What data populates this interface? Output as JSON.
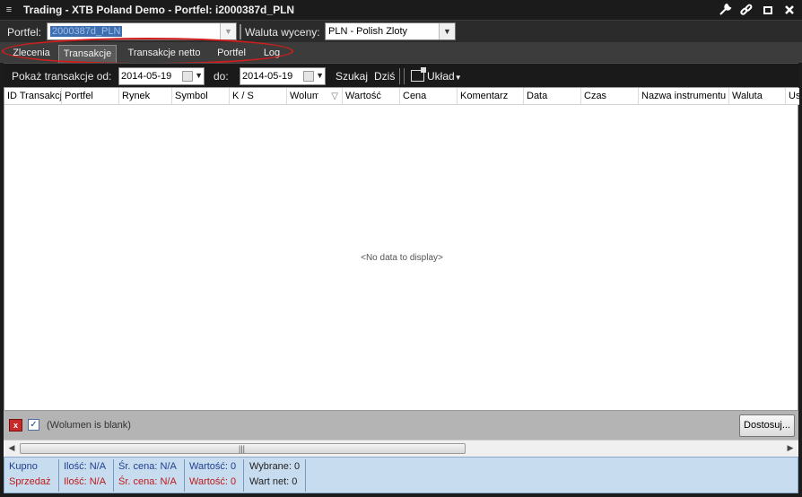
{
  "window": {
    "title": "Trading - XTB Poland Demo - Portfel: i2000387d_PLN",
    "menu_glyph": "≡"
  },
  "portfolio_row": {
    "portfel_label": "Portfel:",
    "portfel_value": "2000387d_PLN",
    "waluta_label": "Waluta wyceny:",
    "waluta_value": "PLN - Polish Zloty"
  },
  "tabs": [
    {
      "label": "Zlecenia",
      "active": false
    },
    {
      "label": "Transakcje",
      "active": true
    },
    {
      "label": "Transakcje netto",
      "active": false
    },
    {
      "label": "Portfel",
      "active": false
    },
    {
      "label": "Log",
      "active": false
    }
  ],
  "filter": {
    "from_label": "Pokaż transakcje od:",
    "from_value": "2014-05-19",
    "to_label": "do:",
    "to_value": "2014-05-19",
    "search_label": "Szukaj",
    "today_label": "Dziś",
    "layout_label": "Układ"
  },
  "grid": {
    "columns": [
      "ID Transakcji",
      "Portfel",
      "Rynek",
      "Symbol",
      "K / S",
      "Wolumen",
      "Wartość",
      "Cena",
      "Komentarz",
      "Data",
      "Czas",
      "Nazwa instrumentu",
      "Waluta",
      "Us"
    ],
    "sort_glyph": "▽",
    "empty_text": "<No data to display>"
  },
  "filter_status": {
    "text": "(Wolumen is blank)",
    "close_glyph": "x",
    "check_glyph": "✓",
    "customize_label": "Dostosuj..."
  },
  "scrollbar": {
    "left_glyph": "◀",
    "right_glyph": "▶",
    "grip_glyph": "|||"
  },
  "summary": {
    "buy_label": "Kupno",
    "sell_label": "Sprzedaż",
    "qty_buy": "Ilość: N/A",
    "qty_sell": "Ilość: N/A",
    "avg_buy": "Śr. cena: N/A",
    "avg_sell": "Śr. cena: N/A",
    "value_buy": "Wartość: 0",
    "value_sell": "Wartość: 0",
    "selected": "Wybrane: 0",
    "net_value": "Wart net: 0"
  },
  "colors": {
    "annotation_ellipse": "#d21d1d",
    "summary_bg": "#c7dcef",
    "buy_text": "#1f3f8f",
    "sell_text": "#c01818"
  }
}
